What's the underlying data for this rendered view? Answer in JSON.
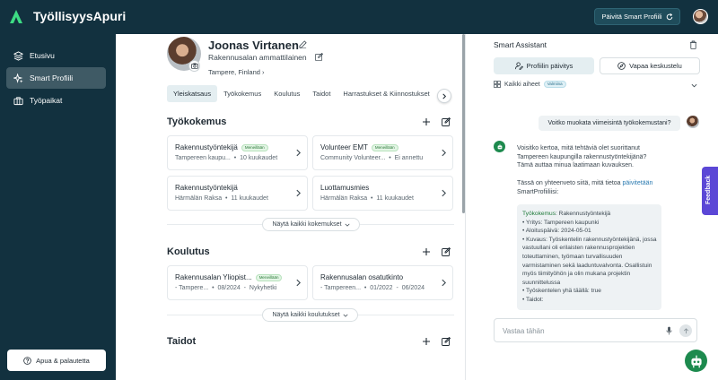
{
  "app": {
    "title": "TyöllisyysApuri",
    "update_button": "Päivitä Smart Profiili",
    "brand_color": "#12313f"
  },
  "sidebar": {
    "items": [
      {
        "label": "Etusivu",
        "icon": "home-icon"
      },
      {
        "label": "Smart Profiili",
        "icon": "sparkle-icon"
      },
      {
        "label": "Työpaikat",
        "icon": "briefcase-icon"
      }
    ],
    "help_button": "Apua & palautetta"
  },
  "profile": {
    "name": "Joonas Virtanen",
    "title": "Rakennusalan ammattilainen",
    "location": "Tampere, Finland"
  },
  "tabs": [
    "Yleiskatsaus",
    "Työkokemus",
    "Koulutus",
    "Taidot",
    "Harrastukset & Kiinnostukset"
  ],
  "work": {
    "title": "Työkokemus",
    "cards": [
      {
        "title": "Rakennustyöntekijä",
        "badge": "Meneillään",
        "org": "Tampereen kaupu...",
        "meta": "10 kuukaudet"
      },
      {
        "title": "Volunteer EMT",
        "badge": "Meneillään",
        "org": "Community Volunteer...",
        "meta": "Ei annettu"
      },
      {
        "title": "Rakennustyöntekijä",
        "badge": "",
        "org": "Härmälän Raksa",
        "meta": "11 kuukaudet"
      },
      {
        "title": "Luottamusmies",
        "badge": "",
        "org": "Härmälän Raksa",
        "meta": "11 kuukaudet"
      }
    ],
    "show_all": "Näytä kaikki kokemukset"
  },
  "education": {
    "title": "Koulutus",
    "cards": [
      {
        "title": "Rakennusalan Yliopist...",
        "badge": "Meneillään",
        "org": "Tampere...",
        "date": "08/2024",
        "meta": "Nykyhetki"
      },
      {
        "title": "Rakennusalan osatutkinto",
        "badge": "",
        "org": "Tampereen...",
        "date": "01/2022",
        "meta": "06/2024"
      }
    ],
    "show_all": "Näytä kaikki koulutukset"
  },
  "skills": {
    "title": "Taidot"
  },
  "assistant": {
    "title": "Smart Assistant",
    "tab_update": "Profiilin päivitys",
    "tab_free": "Vapaa keskustelu",
    "topics_label": "Kaikki aiheet",
    "topics_badge": "Valmiina",
    "user_message": "Voitko muokata viimeisintä työkokemustani?",
    "bot_p1": "Voisitko kertoa, mitä tehtäviä olet suorittanut Tampereen kaupungilla rakennustyöntekijänä? Tämä auttaa minua laatimaan kuvauksen.",
    "bot_p2_pre": "Tässä on yhteenveto siitä, mitä tietoa ",
    "bot_p2_link": "päivitetään",
    "bot_p2_post": " SmartProfiiliisi:",
    "wexp_key": "Työkokemus",
    "wexp_title": ": Rakennustyöntekijä",
    "wexp_lines": [
      "• Yritys: Tampereen kaupunki",
      "• Aloituspäivä: 2024-05-01",
      "• Kuvaus: Työskentelin rakennustyöntekijänä, jossa vastuullani oli erilaisten rakennusprojektien toteuttaminen, työmaan turvallisuuden varmistaminen sekä laaduntuvalvonta. Osallistuin myös tiimityöhön ja olin mukana projektin suunnittelussa",
      "• Työskentelen yhä täällä: true",
      "• Taidot:"
    ],
    "input_placeholder": "Vastaa tähän",
    "feedback": "Feedback"
  }
}
